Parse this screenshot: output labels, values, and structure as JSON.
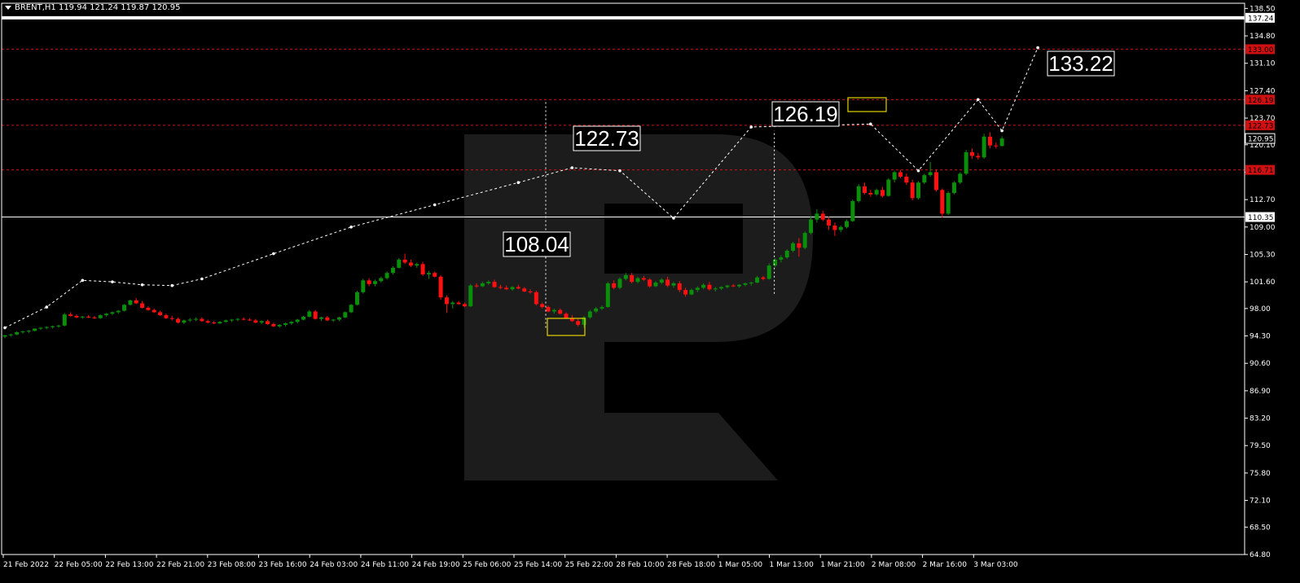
{
  "header": {
    "symbol_line": "BRENT,H1  119.94 121.24 119.87 120.95"
  },
  "colors": {
    "background": "#000000",
    "bull": "#0a8f0a",
    "bear": "#ff1010",
    "level_line": "#d01010",
    "axis_text": "#ffffff",
    "annotation_box": "#e6d200",
    "watermark": "#1c1c1c"
  },
  "chart_data": {
    "type": "candlestick",
    "ylim": [
      64.8,
      139.2
    ],
    "y_ticks": [
      "138.50",
      "134.80",
      "131.10",
      "127.40",
      "123.70",
      "120.10",
      "116.40",
      "112.70",
      "109.00",
      "105.30",
      "101.60",
      "98.00",
      "94.30",
      "90.60",
      "86.90",
      "83.20",
      "79.50",
      "75.80",
      "72.10",
      "68.50",
      "64.80"
    ],
    "x_ticks": [
      "21 Feb 2022",
      "22 Feb 05:00",
      "22 Feb 13:00",
      "22 Feb 21:00",
      "23 Feb 08:00",
      "23 Feb 16:00",
      "24 Feb 03:00",
      "24 Feb 11:00",
      "24 Feb 19:00",
      "25 Feb 06:00",
      "25 Feb 14:00",
      "25 Feb 22:00",
      "28 Feb 10:00",
      "28 Feb 18:00",
      "1 Mar 05:00",
      "1 Mar 13:00",
      "1 Mar 21:00",
      "2 Mar 08:00",
      "2 Mar 16:00",
      "3 Mar 03:00"
    ],
    "price_labels": [
      {
        "text": "137.24",
        "value": 137.24,
        "style": "white"
      },
      {
        "text": "133.00",
        "value": 133.0,
        "style": "red"
      },
      {
        "text": "126.19",
        "value": 126.19,
        "style": "red"
      },
      {
        "text": "122.73",
        "value": 122.73,
        "style": "red"
      },
      {
        "text": "120.95",
        "value": 120.95,
        "style": "current"
      },
      {
        "text": "116.71",
        "value": 116.71,
        "style": "red"
      },
      {
        "text": "110.35",
        "value": 110.35,
        "style": "white"
      }
    ],
    "level_lines": [
      {
        "value": 137.24,
        "style": "thick-white"
      },
      {
        "value": 133.0,
        "style": "dashed-red"
      },
      {
        "value": 126.19,
        "style": "dashed-red"
      },
      {
        "value": 122.73,
        "style": "dashed-red"
      },
      {
        "value": 116.71,
        "style": "dashed-red"
      },
      {
        "value": 110.35,
        "style": "thin-white"
      }
    ],
    "annotations": [
      {
        "text": "133.22"
      },
      {
        "text": "126.19"
      },
      {
        "text": "122.73"
      },
      {
        "text": "108.04"
      }
    ],
    "candles": [
      [
        94.2,
        94.4,
        94.0,
        94.4
      ],
      [
        94.4,
        94.6,
        94.2,
        94.5
      ],
      [
        94.5,
        94.9,
        94.4,
        94.8
      ],
      [
        94.8,
        95.0,
        94.6,
        94.9
      ],
      [
        94.9,
        95.1,
        94.7,
        95.0
      ],
      [
        95.0,
        95.3,
        94.9,
        95.3
      ],
      [
        95.3,
        95.5,
        95.1,
        95.4
      ],
      [
        95.4,
        95.6,
        95.2,
        95.5
      ],
      [
        95.5,
        95.7,
        95.3,
        95.6
      ],
      [
        95.6,
        95.8,
        95.4,
        95.7
      ],
      [
        95.7,
        97.4,
        95.6,
        97.2
      ],
      [
        97.2,
        97.5,
        96.9,
        97.0
      ],
      [
        97.0,
        97.2,
        96.7,
        96.8
      ],
      [
        96.8,
        97.0,
        96.6,
        96.9
      ],
      [
        96.9,
        97.1,
        96.7,
        96.8
      ],
      [
        96.8,
        97.0,
        96.6,
        96.7
      ],
      [
        96.7,
        97.2,
        96.6,
        97.1
      ],
      [
        97.1,
        97.4,
        96.9,
        97.3
      ],
      [
        97.3,
        97.6,
        97.1,
        97.5
      ],
      [
        97.5,
        97.8,
        97.3,
        97.7
      ],
      [
        97.7,
        98.6,
        97.6,
        98.5
      ],
      [
        98.5,
        99.2,
        98.4,
        99.1
      ],
      [
        99.1,
        99.4,
        98.6,
        98.7
      ],
      [
        98.7,
        99.0,
        98.0,
        98.1
      ],
      [
        98.1,
        98.3,
        97.7,
        97.8
      ],
      [
        97.8,
        98.0,
        97.4,
        97.5
      ],
      [
        97.5,
        97.7,
        97.0,
        97.1
      ],
      [
        97.1,
        97.3,
        96.6,
        96.7
      ],
      [
        96.7,
        97.0,
        96.4,
        96.6
      ],
      [
        96.6,
        96.8,
        96.0,
        96.1
      ],
      [
        96.1,
        96.5,
        95.9,
        96.4
      ],
      [
        96.4,
        96.7,
        96.2,
        96.5
      ],
      [
        96.5,
        96.8,
        96.3,
        96.6
      ],
      [
        96.6,
        96.8,
        96.2,
        96.3
      ],
      [
        96.3,
        96.5,
        96.0,
        96.1
      ],
      [
        96.1,
        96.3,
        95.9,
        96.0
      ],
      [
        96.0,
        96.3,
        95.9,
        96.2
      ],
      [
        96.2,
        96.5,
        96.1,
        96.4
      ],
      [
        96.4,
        96.6,
        96.2,
        96.5
      ],
      [
        96.5,
        96.7,
        96.3,
        96.6
      ],
      [
        96.6,
        96.8,
        96.4,
        96.5
      ],
      [
        96.5,
        96.7,
        96.3,
        96.4
      ],
      [
        96.4,
        96.6,
        96.0,
        96.1
      ],
      [
        96.1,
        96.4,
        95.9,
        96.3
      ],
      [
        96.3,
        96.5,
        95.8,
        95.9
      ],
      [
        95.9,
        96.1,
        95.5,
        95.6
      ],
      [
        95.6,
        95.9,
        95.4,
        95.8
      ],
      [
        95.8,
        96.1,
        95.6,
        96.0
      ],
      [
        96.0,
        96.3,
        95.8,
        96.2
      ],
      [
        96.2,
        96.6,
        96.0,
        96.5
      ],
      [
        96.5,
        97.0,
        96.4,
        96.9
      ],
      [
        96.9,
        97.8,
        96.8,
        97.6
      ],
      [
        97.6,
        97.8,
        96.5,
        96.6
      ],
      [
        96.6,
        96.9,
        96.3,
        96.8
      ],
      [
        96.8,
        97.0,
        96.3,
        96.4
      ],
      [
        96.4,
        96.6,
        96.2,
        96.5
      ],
      [
        96.5,
        96.9,
        96.3,
        96.8
      ],
      [
        96.8,
        97.6,
        96.7,
        97.5
      ],
      [
        97.5,
        98.6,
        97.4,
        98.5
      ],
      [
        98.5,
        100.4,
        98.4,
        100.2
      ],
      [
        100.2,
        102.0,
        100.0,
        101.8
      ],
      [
        101.8,
        102.1,
        101.0,
        101.3
      ],
      [
        101.3,
        101.9,
        101.0,
        101.7
      ],
      [
        101.7,
        102.3,
        101.5,
        102.1
      ],
      [
        102.1,
        103.0,
        101.9,
        102.8
      ],
      [
        102.8,
        103.7,
        102.6,
        103.5
      ],
      [
        103.5,
        104.8,
        103.4,
        104.6
      ],
      [
        104.6,
        105.4,
        104.0,
        104.2
      ],
      [
        104.2,
        104.6,
        103.6,
        103.8
      ],
      [
        103.8,
        104.2,
        103.5,
        104.0
      ],
      [
        104.0,
        104.3,
        102.4,
        102.6
      ],
      [
        102.6,
        103.1,
        102.0,
        102.8
      ],
      [
        102.8,
        103.0,
        102.2,
        102.3
      ],
      [
        102.3,
        102.5,
        99.2,
        99.5
      ],
      [
        99.5,
        99.8,
        97.4,
        98.6
      ],
      [
        98.6,
        99.0,
        98.0,
        98.8
      ],
      [
        98.8,
        99.0,
        98.5,
        98.6
      ],
      [
        98.6,
        98.8,
        98.2,
        98.3
      ],
      [
        98.3,
        101.3,
        98.2,
        101.1
      ],
      [
        101.1,
        101.4,
        100.8,
        101.0
      ],
      [
        101.0,
        101.6,
        100.9,
        101.4
      ],
      [
        101.4,
        101.8,
        101.2,
        101.6
      ],
      [
        101.6,
        101.9,
        100.8,
        100.9
      ],
      [
        100.9,
        101.2,
        100.6,
        100.8
      ],
      [
        100.8,
        101.1,
        100.5,
        100.6
      ],
      [
        100.6,
        101.0,
        100.4,
        100.9
      ],
      [
        100.9,
        101.2,
        100.6,
        100.7
      ],
      [
        100.7,
        100.9,
        100.2,
        100.3
      ],
      [
        100.3,
        100.6,
        100.0,
        100.2
      ],
      [
        100.2,
        100.4,
        98.4,
        98.6
      ],
      [
        98.6,
        98.8,
        98.0,
        98.2
      ],
      [
        98.2,
        98.4,
        97.5,
        97.6
      ],
      [
        97.6,
        98.0,
        97.3,
        97.8
      ],
      [
        97.8,
        98.0,
        97.2,
        97.3
      ],
      [
        97.3,
        97.5,
        96.6,
        96.7
      ],
      [
        96.7,
        97.1,
        96.2,
        96.3
      ],
      [
        96.3,
        96.6,
        95.6,
        95.8
      ],
      [
        95.8,
        97.0,
        95.4,
        96.8
      ],
      [
        96.8,
        97.8,
        96.6,
        97.6
      ],
      [
        97.6,
        98.2,
        97.4,
        98.0
      ],
      [
        98.0,
        98.4,
        97.8,
        98.2
      ],
      [
        98.2,
        101.6,
        98.1,
        101.4
      ],
      [
        101.4,
        101.8,
        100.6,
        100.8
      ],
      [
        100.8,
        102.2,
        100.6,
        102.0
      ],
      [
        102.0,
        102.8,
        101.8,
        102.5
      ],
      [
        102.5,
        102.8,
        101.4,
        101.6
      ],
      [
        101.6,
        102.3,
        101.4,
        102.1
      ],
      [
        102.1,
        102.4,
        101.7,
        101.9
      ],
      [
        101.9,
        102.1,
        100.8,
        101.0
      ],
      [
        101.0,
        101.7,
        100.9,
        101.5
      ],
      [
        101.5,
        102.1,
        101.3,
        101.9
      ],
      [
        101.9,
        102.3,
        100.9,
        101.1
      ],
      [
        101.1,
        101.6,
        100.8,
        101.4
      ],
      [
        101.4,
        101.7,
        100.2,
        100.5
      ],
      [
        100.5,
        100.8,
        99.6,
        99.9
      ],
      [
        99.9,
        100.7,
        99.8,
        100.5
      ],
      [
        100.5,
        101.0,
        100.2,
        100.8
      ],
      [
        100.8,
        101.4,
        100.6,
        101.2
      ],
      [
        101.2,
        101.6,
        100.4,
        100.6
      ],
      [
        100.6,
        100.9,
        100.3,
        100.7
      ],
      [
        100.7,
        101.0,
        100.5,
        100.9
      ],
      [
        100.9,
        101.2,
        100.7,
        101.1
      ],
      [
        101.1,
        101.3,
        100.9,
        101.0
      ],
      [
        101.0,
        101.3,
        100.8,
        101.2
      ],
      [
        101.2,
        101.5,
        101.0,
        101.4
      ],
      [
        101.4,
        101.6,
        101.1,
        101.5
      ],
      [
        101.5,
        102.4,
        101.4,
        102.2
      ],
      [
        102.2,
        102.4,
        101.8,
        102.0
      ],
      [
        102.0,
        104.1,
        101.9,
        103.8
      ],
      [
        103.8,
        104.8,
        103.6,
        104.6
      ],
      [
        104.6,
        105.2,
        104.2,
        104.9
      ],
      [
        104.9,
        106.0,
        104.7,
        105.8
      ],
      [
        105.8,
        107.0,
        105.6,
        106.8
      ],
      [
        106.8,
        107.5,
        105.0,
        106.2
      ],
      [
        106.2,
        108.4,
        106.0,
        108.2
      ],
      [
        108.2,
        110.5,
        108.0,
        110.0
      ],
      [
        110.0,
        111.4,
        109.6,
        110.8
      ],
      [
        110.8,
        111.2,
        109.8,
        110.0
      ],
      [
        110.0,
        110.4,
        108.6,
        109.2
      ],
      [
        109.2,
        109.6,
        107.8,
        108.6
      ],
      [
        108.6,
        109.2,
        108.3,
        109.0
      ],
      [
        109.0,
        110.0,
        108.8,
        109.8
      ],
      [
        109.8,
        112.7,
        109.7,
        112.5
      ],
      [
        112.5,
        114.8,
        112.3,
        114.5
      ],
      [
        114.5,
        115.0,
        113.4,
        113.6
      ],
      [
        113.6,
        114.0,
        113.1,
        113.4
      ],
      [
        113.4,
        114.2,
        113.2,
        114.0
      ],
      [
        114.0,
        114.4,
        113.0,
        113.2
      ],
      [
        113.2,
        115.6,
        113.1,
        115.4
      ],
      [
        115.4,
        116.6,
        115.0,
        116.4
      ],
      [
        116.4,
        116.7,
        115.6,
        115.8
      ],
      [
        115.8,
        116.2,
        114.7,
        115.0
      ],
      [
        115.0,
        115.4,
        112.6,
        112.9
      ],
      [
        112.9,
        115.2,
        112.7,
        115.0
      ],
      [
        115.0,
        116.2,
        114.8,
        116.0
      ],
      [
        116.0,
        117.8,
        115.8,
        116.4
      ],
      [
        116.4,
        116.8,
        113.8,
        114.0
      ],
      [
        114.0,
        114.2,
        110.3,
        110.8
      ],
      [
        110.8,
        113.8,
        110.6,
        113.6
      ],
      [
        113.6,
        115.2,
        113.4,
        115.0
      ],
      [
        115.0,
        116.4,
        114.8,
        116.2
      ],
      [
        116.2,
        119.4,
        116.0,
        119.1
      ],
      [
        119.1,
        119.6,
        118.2,
        118.6
      ],
      [
        118.6,
        119.0,
        118.1,
        118.4
      ],
      [
        118.4,
        121.6,
        118.2,
        121.2
      ],
      [
        121.2,
        121.8,
        119.6,
        120.0
      ],
      [
        120.0,
        120.4,
        119.6,
        119.9
      ],
      [
        119.94,
        121.24,
        119.87,
        120.95
      ]
    ],
    "projection_path": [
      [
        0,
        95.4
      ],
      [
        7,
        98.2
      ],
      [
        13,
        101.8
      ],
      [
        18,
        101.6
      ],
      [
        23,
        101.2
      ],
      [
        28,
        101.1
      ],
      [
        33,
        102.0
      ],
      [
        45,
        105.4
      ],
      [
        58,
        109.0
      ],
      [
        72,
        112.0
      ],
      [
        86,
        115.0
      ],
      [
        95,
        117.0
      ],
      [
        103,
        116.6
      ],
      [
        112,
        110.2
      ],
      [
        125,
        122.5
      ],
      [
        145,
        122.9
      ],
      [
        153,
        116.6
      ],
      [
        163,
        126.2
      ],
      [
        167,
        122.0
      ],
      [
        173,
        133.2
      ]
    ],
    "segments": [
      {
        "x_index": 0,
        "from": 95.4,
        "to": 126.19
      },
      {
        "x_index": 20,
        "from": 100.0,
        "to": 122.0
      }
    ]
  }
}
